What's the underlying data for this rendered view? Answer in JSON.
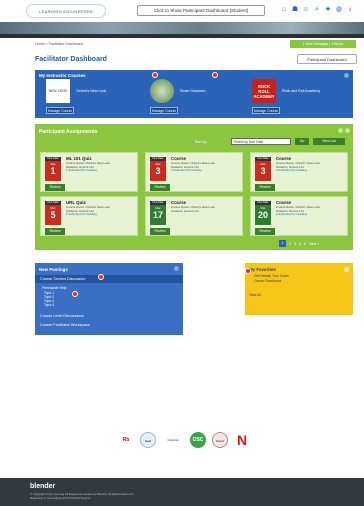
{
  "header": {
    "logo_text": "LEARNING ENGINEERED",
    "dashboard_toggle": "Click to Show Participant Dashboard [Student]",
    "icons": [
      "home-icon",
      "users-icon",
      "people-icon",
      "search-icon",
      "star-icon",
      "globe-icon",
      "bell-icon"
    ]
  },
  "breadcrumb": "Home > Facilitator Dashboard",
  "message_bar": "1 New Message | 2 Alerts",
  "page_title": "Facilitator Dashboard",
  "participant_dashboard_button": "Participant Dashboard",
  "instructor_courses": {
    "title": "My Instructor Courses",
    "manage_label": "Manage Course",
    "courses": [
      {
        "thumb_text": "NEW LOOK",
        "title": "Oxford's New Look"
      },
      {
        "thumb_text": "",
        "title": "Smart Outdoors"
      },
      {
        "thumb_text": "ROCK ROLL ACADEMY",
        "title": "Rock and Roll Academy"
      }
    ]
  },
  "assignments": {
    "title": "Participant Assignments",
    "sort_label": "Sort by:",
    "sort_value": "Select by Due Date",
    "go_label": "Go",
    "view_list_label": "View List",
    "review_label": "Review",
    "items": [
      {
        "due": "Due Date",
        "month": "Mar",
        "day": "1",
        "title": "ML 101 Quiz",
        "meta1": "Course Name: Oxford's New Look",
        "meta2": "Students: Honors List",
        "meta3": "1 Submitted for Grading",
        "color": "red"
      },
      {
        "due": "Due Date",
        "month": "Mar",
        "day": "3",
        "title": "Course",
        "meta1": "Course Name: Oxford's New Look",
        "meta2": "Students: Honors List",
        "meta3": "3 Submitted for Grading",
        "color": "red"
      },
      {
        "due": "Due Date",
        "month": "Mar",
        "day": "3",
        "title": "Course",
        "meta1": "Course Name: Oxford's New Look",
        "meta2": "Students: Honors List",
        "meta3": "3 Submitted for Grading",
        "color": "red"
      },
      {
        "due": "Due Date",
        "month": "Mar",
        "day": "5",
        "title": "URL Quiz",
        "meta1": "Course Name: Oxford's New Look",
        "meta2": "Students: Honors List",
        "meta3": "5 Submitted for Grading",
        "color": "red"
      },
      {
        "due": "Due Date",
        "month": "Mar",
        "day": "17",
        "title": "Course",
        "meta1": "Course Name: Oxford's New Look",
        "meta2": "Students: Honors List",
        "meta3": "",
        "color": "green"
      },
      {
        "due": "Due Date",
        "month": "Mar",
        "day": "20",
        "title": "Course",
        "meta1": "Course Name: Oxford's New Look",
        "meta2": "Students: Honors List",
        "meta3": "2 Submitted for Grading",
        "color": "green"
      }
    ],
    "pager": [
      "1",
      "2",
      "3",
      "4",
      "5",
      "Next »"
    ]
  },
  "new_postings": {
    "title": "New Postings",
    "highlight": "Course Section Discussion",
    "sub_title": "Prerequisite Help",
    "topics": [
      "Topic 1",
      "Topic 2",
      "Topic 3",
      "Topic 4"
    ],
    "rows": [
      "Course Level Discussions",
      "Course Facilitator Workspace"
    ]
  },
  "favorites": {
    "title": "My Favorites",
    "items": [
      "Get Ready! Your Goals",
      "Career Readiness"
    ],
    "view_all": "View All"
  },
  "partners": [
    "Rb",
    "Seal",
    "Cursive",
    "OSC",
    "Crest",
    "N"
  ],
  "footer": {
    "brand": "blender",
    "copyright": "© Copyright All for Learning All Engineered service by Blender. All Rights Reserved.",
    "links": "Read Now or Get Helping and Technical Support"
  },
  "colors": {
    "brand_blue": "#2b63b8",
    "assign_green": "#8cc63f",
    "fav_yellow": "#f5c518",
    "due_red": "#cc2a1e",
    "due_green": "#2e7d32"
  }
}
